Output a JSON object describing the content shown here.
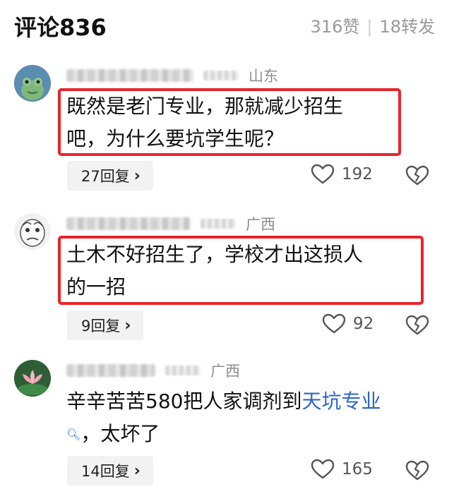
{
  "header": {
    "title": "评论836",
    "likes": "316赞",
    "separator": "|",
    "reposts": "18转发"
  },
  "comments": [
    {
      "region": "山东",
      "text": "既然是老门专业，那就减少招生吧，为什么要坑学生呢？",
      "line1": "既然是老门专业，那就减少招生",
      "line2": "吧，为什么要坑学生呢？",
      "replies": "27回复",
      "likes": "192",
      "avatar_icon": "frog-avatar-icon"
    },
    {
      "region": "广西",
      "line1": "土木不好招生了，学校才出这损人",
      "line2": "的一招",
      "replies": "9回复",
      "likes": "92",
      "avatar_icon": "meme-face-avatar-icon"
    },
    {
      "region": "广西",
      "line1_prefix": "辛辛苦苦580把人家调剂到",
      "line1_link": "天坑专业",
      "line2": "，太坏了",
      "replies": "14回复",
      "likes": "165",
      "avatar_icon": "lotus-avatar-icon"
    }
  ],
  "colors": {
    "highlight_box": "#e8242b",
    "link": "#2b66c7",
    "muted": "#9a9a9a"
  }
}
